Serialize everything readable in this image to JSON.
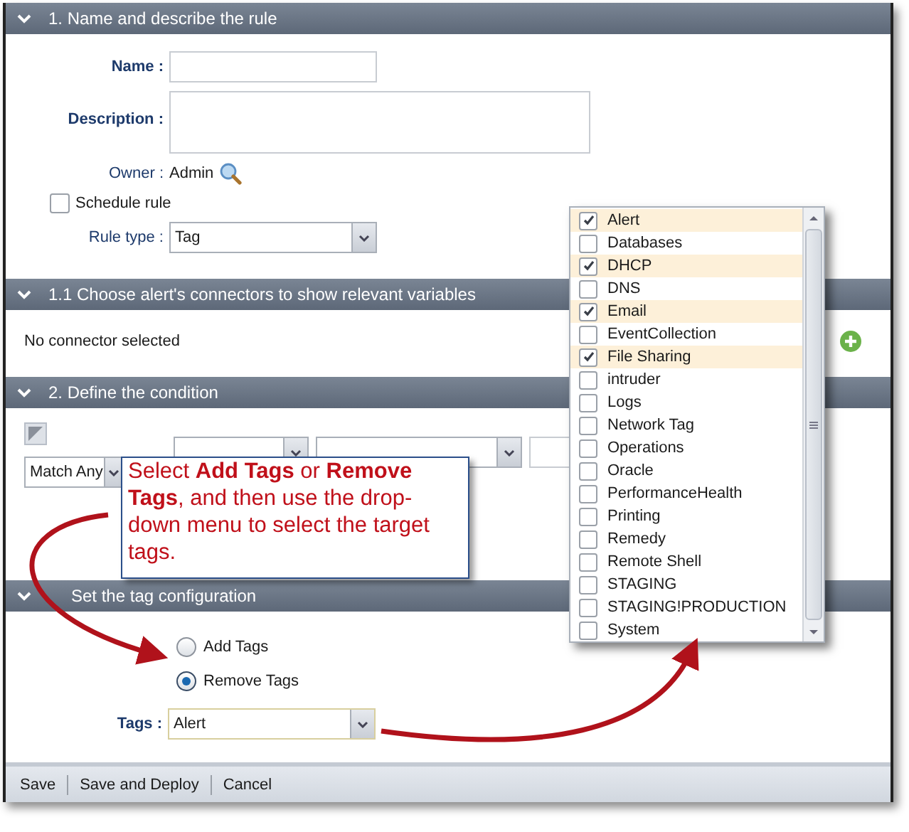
{
  "section_1": {
    "title": "1. Name and describe the rule",
    "name_label": "Name :",
    "description_label": "Description :",
    "owner_label": "Owner :",
    "owner_value": "Admin",
    "schedule": {
      "label": "Schedule rule",
      "checked": false
    },
    "rule_type": {
      "label": "Rule type :",
      "value": "Tag"
    }
  },
  "section_1_1": {
    "title": "1.1 Choose alert's connectors to show relevant variables",
    "message": "No connector selected"
  },
  "section_2": {
    "title": "2. Define the condition",
    "match_value": "Match Any"
  },
  "section_3": {
    "title": "Set the tag configuration",
    "options": [
      {
        "label": "Add Tags",
        "selected": false
      },
      {
        "label": "Remove Tags",
        "selected": true
      }
    ],
    "tags_label": "Tags :",
    "tags_value": "Alert"
  },
  "footer": {
    "buttons": [
      "Save",
      "Save and Deploy",
      "Cancel"
    ]
  },
  "tag_list": {
    "items": [
      {
        "label": "Alert",
        "checked": true
      },
      {
        "label": "Databases",
        "checked": false
      },
      {
        "label": "DHCP",
        "checked": true
      },
      {
        "label": "DNS",
        "checked": false
      },
      {
        "label": "Email",
        "checked": true
      },
      {
        "label": "EventCollection",
        "checked": false
      },
      {
        "label": "File Sharing",
        "checked": true
      },
      {
        "label": "intruder",
        "checked": false
      },
      {
        "label": "Logs",
        "checked": false
      },
      {
        "label": "Network Tag",
        "checked": false
      },
      {
        "label": "Operations",
        "checked": false
      },
      {
        "label": "Oracle",
        "checked": false
      },
      {
        "label": "PerformanceHealth",
        "checked": false
      },
      {
        "label": "Printing",
        "checked": false
      },
      {
        "label": "Remedy",
        "checked": false
      },
      {
        "label": "Remote Shell",
        "checked": false
      },
      {
        "label": "STAGING",
        "checked": false
      },
      {
        "label": "STAGING!PRODUCTION",
        "checked": false
      },
      {
        "label": "System",
        "checked": false
      }
    ]
  },
  "callout": {
    "text": "Select **Add Tags** or **Remove Tags**, and then use the drop-down menu to select the target tags."
  }
}
